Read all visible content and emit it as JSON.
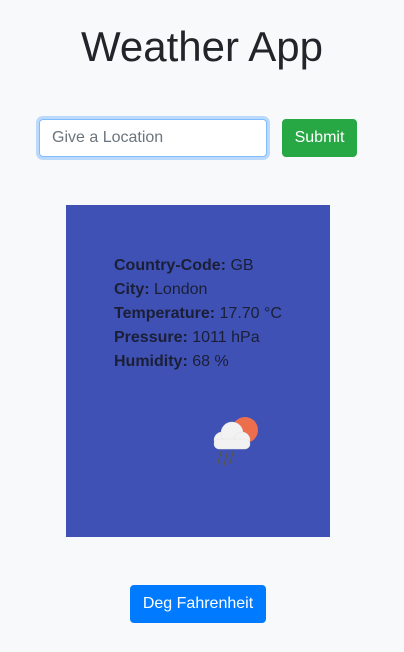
{
  "app": {
    "title": "Weather App"
  },
  "search": {
    "placeholder": "Give a Location",
    "value": "",
    "submit_label": "Submit"
  },
  "weather": {
    "country_code_label": "Country-Code:",
    "country_code_value": "GB",
    "city_label": "City:",
    "city_value": "London",
    "temperature_label": "Temperature:",
    "temperature_value": "17.70 °C",
    "pressure_label": "Pressure:",
    "pressure_value": "1011 hPa",
    "humidity_label": "Humidity:",
    "humidity_value": "68 %",
    "icon": "cloud-sun-rain-icon",
    "card_color": "#3f51b5"
  },
  "units": {
    "toggle_label": "Deg Fahrenheit"
  }
}
